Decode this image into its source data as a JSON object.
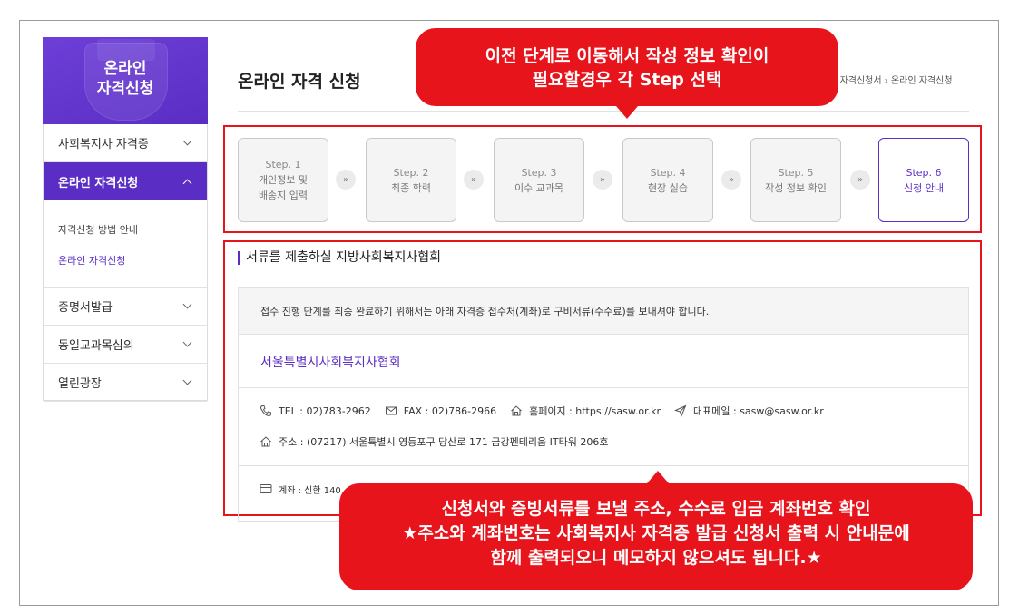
{
  "sidebar": {
    "banner_title": "온라인\n자격신청",
    "menu": [
      {
        "label": "사회복지사 자격증",
        "expanded": false
      },
      {
        "label": "온라인 자격신청",
        "expanded": true
      },
      {
        "label": "증명서발급",
        "expanded": false
      },
      {
        "label": "동일교과목심의",
        "expanded": false
      },
      {
        "label": "열린광장",
        "expanded": false
      }
    ],
    "submenu": [
      {
        "label": "자격신청 방법 안내",
        "current": false
      },
      {
        "label": "온라인 자격신청",
        "current": true
      }
    ]
  },
  "header": {
    "page_title": "온라인 자격 신청",
    "breadcrumb": "라인 자격신청서 › 온라인 자격신청"
  },
  "steps": [
    {
      "num": "Step. 1",
      "label": "개인정보 및 배송지 입력",
      "active": false
    },
    {
      "num": "Step. 2",
      "label": "최종 학력",
      "active": false
    },
    {
      "num": "Step. 3",
      "label": "이수 교과목",
      "active": false
    },
    {
      "num": "Step. 4",
      "label": "현장 실습",
      "active": false
    },
    {
      "num": "Step. 5",
      "label": "작성 정보 확인",
      "active": false
    },
    {
      "num": "Step. 6",
      "label": "신청 안내",
      "active": true
    }
  ],
  "step_arrow_glyph": "»",
  "info": {
    "section_title": "서류를 제출하실 지방사회복지사협회",
    "notice": "접수 진행 단계를 최종 완료하기 위해서는 아래 자격증 접수처(계좌)로 구비서류(수수료)를 보내셔야 합니다.",
    "org_name": "서울특별시사회복지사협회",
    "tel": "TEL : 02)783-2962",
    "fax": "FAX : 02)786-2966",
    "homepage": "홈페이지 : https://sasw.or.kr",
    "email": "대표메일 : sasw@sasw.or.kr",
    "address": "주소 : (07217) 서울특별시 영등포구 당산로 171 금강펜테리움 IT타워 206호",
    "account": "계좌 : 신한 140"
  },
  "callouts": {
    "top": [
      "이전 단계로 이동해서 작성 정보 확인이",
      "필요할경우 각 Step 선택"
    ],
    "bottom": [
      "신청서와 증빙서류를 보낼 주소, 수수료 입금 계좌번호 확인",
      "★주소와 계좌번호는 사회복지사 자격증 발급 신청서 출력 시 안내문에",
      "함께 출력되오니 메모하지 않으셔도 됩니다.★"
    ]
  },
  "colors": {
    "brand_purple": "#5a2ec4",
    "callout_red": "#e8141c"
  },
  "icons": [
    "phone-icon",
    "mail-icon",
    "home-icon",
    "send-icon",
    "address-home-icon",
    "card-icon",
    "chevron-down-icon",
    "chevron-up-icon",
    "double-chevron-right-icon"
  ]
}
